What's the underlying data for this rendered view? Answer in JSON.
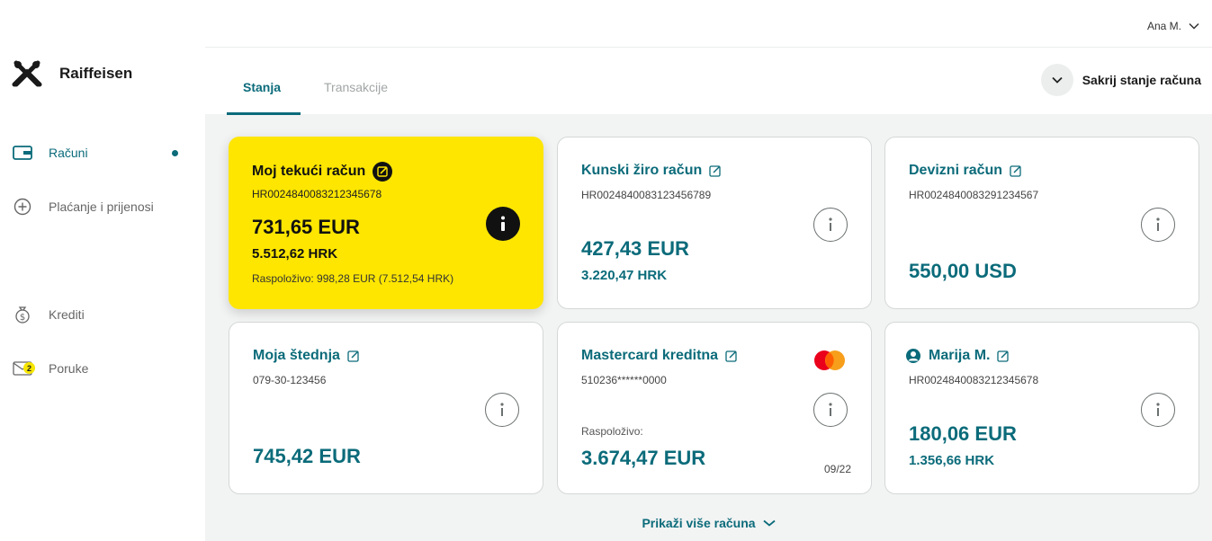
{
  "brand": {
    "name": "Raiffeisen"
  },
  "sidebar": {
    "items": [
      {
        "label": "Računi",
        "icon": "wallet-icon",
        "active": true
      },
      {
        "label": "Plaćanje i prijenosi",
        "icon": "plus-circle-icon"
      },
      {
        "label": "Krediti",
        "icon": "money-bag-icon"
      },
      {
        "label": "Poruke",
        "icon": "envelope-icon",
        "badge": "2"
      }
    ]
  },
  "header": {
    "user": "Ana M."
  },
  "tabs": [
    {
      "label": "Stanja",
      "active": true
    },
    {
      "label": "Transakcije",
      "active": false
    }
  ],
  "actions": {
    "hide_balance": "Sakrij stanje računa",
    "show_more": "Prikaži više računa"
  },
  "accounts": [
    {
      "title": "Moj tekući račun",
      "iban": "HR0024840083212345678",
      "amount": "731,65 EUR",
      "secondary": "5.512,62 HRK",
      "available": "Raspoloživo: 998,28 EUR (7.512,54 HRK)"
    },
    {
      "title": "Kunski žiro račun",
      "iban": "HR0024840083123456789",
      "amount": "427,43 EUR",
      "secondary": "3.220,47 HRK"
    },
    {
      "title": "Devizni račun",
      "iban": "HR0024840083291234567",
      "amount": "550,00 USD"
    },
    {
      "title": "Moja štednja",
      "iban": "079-30-123456",
      "amount": "745,42 EUR"
    },
    {
      "title": "Mastercard kreditna",
      "iban": "510236******0000",
      "available_label": "Raspoloživo:",
      "amount": "3.674,47 EUR",
      "expiry": "09/22"
    },
    {
      "title": "Marija M.",
      "iban": "HR0024840083212345678",
      "amount": "180,06 EUR",
      "secondary": "1.356,66 HRK"
    }
  ],
  "colors": {
    "accent": "#0b6b7a",
    "highlight": "#fee600",
    "background": "#f2f3f3"
  }
}
